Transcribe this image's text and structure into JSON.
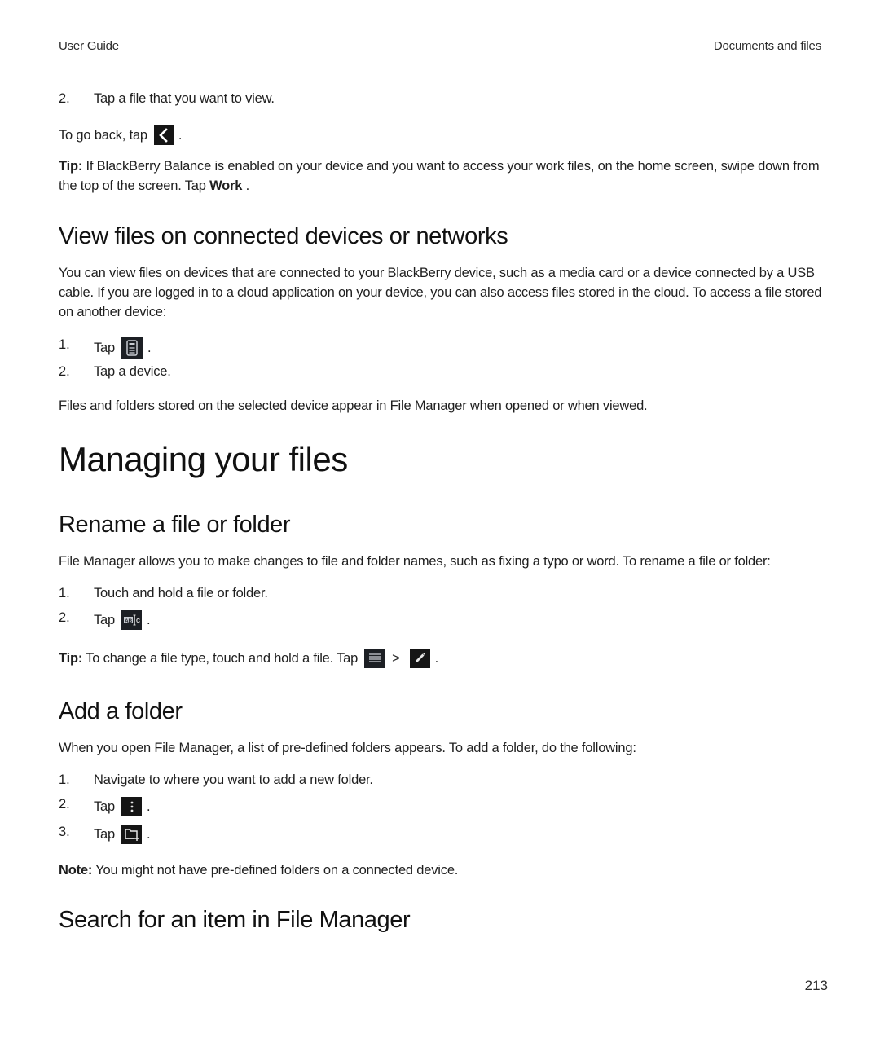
{
  "header": {
    "left": "User Guide",
    "right": "Documents and files"
  },
  "intro": {
    "step2_num": "2.",
    "step2_text": "Tap a file that you want to view.",
    "go_back_text": "To go back, tap",
    "go_back_icon": "back-chevron-icon",
    "tip_label": "Tip:",
    "tip_text": " If BlackBerry Balance is enabled on your device and you want to access your work files, on the home screen, swipe down from the top of the screen. Tap ",
    "tip_bold": "Work",
    "tip_end": " ."
  },
  "view_files": {
    "title": "View files on connected devices or networks",
    "paragraph": "You can view files on devices that are connected to your BlackBerry device, such as a media card or a device connected by a USB cable. If you are logged in to a cloud application on your device, you can also access files stored in the cloud. To access a file stored on another device:",
    "steps": [
      {
        "num": "1.",
        "text": "Tap",
        "icon": "device-icon",
        "end": "."
      },
      {
        "num": "2.",
        "text": "Tap a device."
      }
    ],
    "footer": "Files and folders stored on the selected device appear in File Manager when opened or when viewed."
  },
  "chapter_title": "Managing your files",
  "rename": {
    "title": "Rename a file or folder",
    "paragraph": "File Manager allows you to make changes to file and folder names, such as fixing a typo or word. To rename a file or folder:",
    "steps": [
      {
        "num": "1.",
        "text": "Touch and hold a file or folder."
      },
      {
        "num": "2.",
        "text": "Tap",
        "icon": "rename-icon",
        "end": "."
      }
    ],
    "tip_label": "Tip:",
    "tip_text": " To change a file type, touch and hold a file. Tap",
    "tip_icon1": "menu-icon",
    "tip_sep": ">",
    "tip_icon2": "pencil-edit-icon",
    "tip_end": "."
  },
  "add_folder": {
    "title": "Add a folder",
    "paragraph": "When you open File Manager, a list of pre-defined folders appears. To add a folder, do the following:",
    "steps": [
      {
        "num": "1.",
        "text": "Navigate to where you want to add a new folder."
      },
      {
        "num": "2.",
        "text": "Tap",
        "icon": "overflow-menu-icon",
        "end": "."
      },
      {
        "num": "3.",
        "text": "Tap",
        "icon": "new-folder-icon",
        "end": "."
      }
    ],
    "note_label": "Note:",
    "note_text": " You might not have pre-defined folders on a connected device."
  },
  "search": {
    "title": "Search for an item in File Manager"
  },
  "page_number": "213"
}
